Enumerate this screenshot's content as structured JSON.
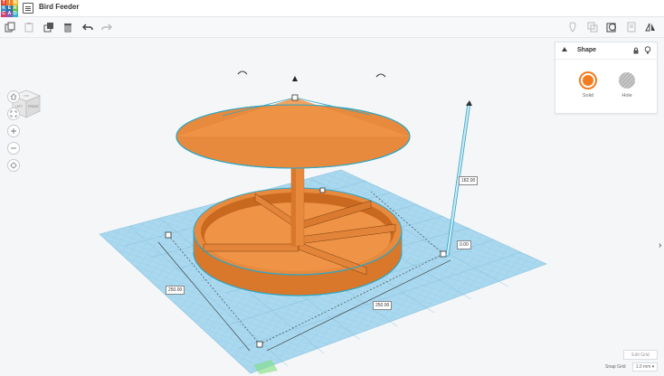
{
  "app": {
    "title": "Bird Feeder",
    "logo_letters": [
      "T",
      "I",
      "N",
      "K",
      "E",
      "R",
      "C",
      "A",
      "D"
    ],
    "logo_colors": [
      "#e8432d",
      "#f07f2a",
      "#f6b72e",
      "#3b8ac4",
      "#2e6ea8",
      "#6fb94a",
      "#d93f6a",
      "#8a5bb0",
      "#3ab5c6"
    ]
  },
  "toolbar": {
    "icons": [
      "copy-icon",
      "paste-icon",
      "duplicate-icon",
      "delete-icon",
      "undo-icon",
      "redo-icon"
    ],
    "right_icons": [
      "note-icon",
      "group-icon",
      "view-icon",
      "notes-icon",
      "mirror-icon"
    ]
  },
  "viewcube": {
    "top_label": "TOP",
    "front_label": "FRONT",
    "left_label": "LEFT"
  },
  "nav": [
    "home-icon",
    "fit-icon",
    "zoom-in-icon",
    "zoom-out-icon",
    "orthographic-icon"
  ],
  "shape_panel": {
    "title": "Shape",
    "solid_label": "Solid",
    "hole_label": "Hole",
    "solid_color": "#f47c20",
    "hole_color": "#b9b9b9"
  },
  "dimensions": {
    "height": "182.00",
    "elevation": "0.00",
    "width": "250.00",
    "depth": "250.00"
  },
  "bottom": {
    "edit_grid": "Edit Grid",
    "snap_grid_label": "Snap Grid",
    "snap_grid_value": "1.0 mm ▾"
  },
  "colors": {
    "workplane": "#a9d8ef",
    "shape": "#e88a3e",
    "shape_dark": "#c56a22",
    "selection": "#2fa6c4"
  }
}
